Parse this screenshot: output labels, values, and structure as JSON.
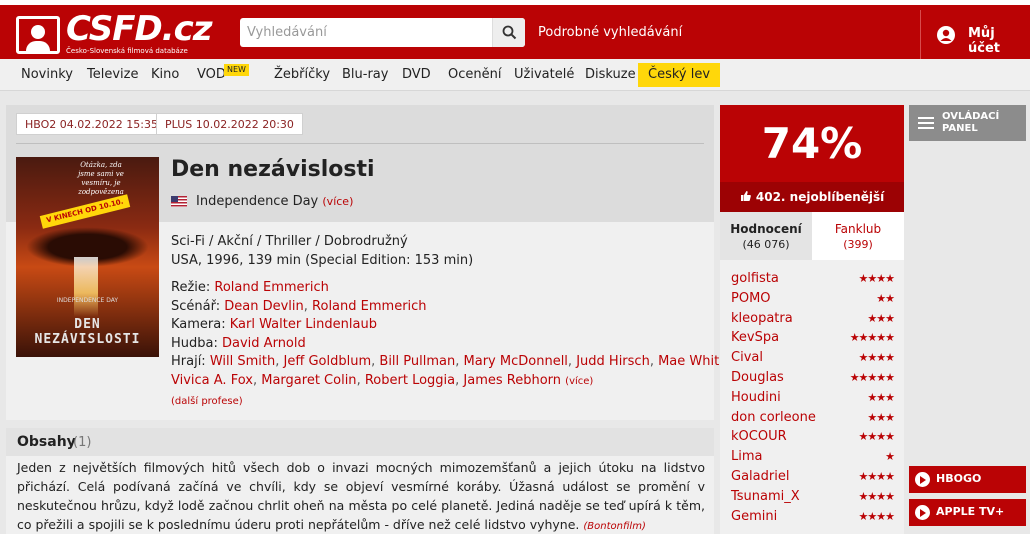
{
  "header": {
    "logo_text": "CSFD.cz",
    "logo_sub": "Česko-Slovenská filmová databáze",
    "search_placeholder": "Vyhledávání",
    "advanced_search": "Podrobné vyhledávání",
    "account": "Můj účet"
  },
  "nav": {
    "items": [
      "Novinky",
      "Televize",
      "Kino",
      "VOD",
      "Žebříčky",
      "Blu-ray",
      "DVD",
      "Ocenění",
      "Uživatelé",
      "Diskuze",
      "Český lev"
    ],
    "new_badge": "NEW"
  },
  "tv": {
    "badge1": "HBO2 04.02.2022 15:35",
    "badge2": "PLUS 10.02.2022 20:30"
  },
  "poster": {
    "tagline": "Otázka, zda jsme sami ve vesmíru, je zodpovězena",
    "banner": "V KINECH OD 10.10.",
    "small": "INDEPENDENCE DAY",
    "title": "DEN NEZÁVISLOSTI"
  },
  "film": {
    "title": "Den nezávislosti",
    "original_title": "Independence Day",
    "more": "(více)",
    "genres": "Sci-Fi / Akční / Thriller / Dobrodružný",
    "origin": "USA, 1996, 139 min (Special Edition: 153 min)"
  },
  "creators": {
    "direction_label": "Režie:",
    "direction": [
      "Roland Emmerich"
    ],
    "script_label": "Scénář:",
    "script": [
      "Dean Devlin",
      "Roland Emmerich"
    ],
    "camera_label": "Kamera:",
    "camera": [
      "Karl Walter Lindenlaub"
    ],
    "music_label": "Hudba:",
    "music": [
      "David Arnold"
    ],
    "cast_label": "Hrají:",
    "cast_line1": [
      "Will Smith",
      "Jeff Goldblum",
      "Bill Pullman",
      "Mary McDonnell",
      "Judd Hirsch",
      "Mae Whitman"
    ],
    "cast_line2": [
      "Vivica A. Fox",
      "Margaret Colin",
      "Robert Loggia",
      "James Rebhorn"
    ],
    "cast_more": "(více)",
    "more_professions": "(další profese)"
  },
  "synopsis": {
    "heading": "Obsahy",
    "count": "(1)",
    "text": "Jeden z největších filmových hitů všech dob o invazi mocných mimozemšťanů a jejich útoku na lidstvo přichází. Celá podívaná začíná ve chvíli, kdy se objeví vesmírné koráby. Úžasná událost se promění v neskutečnou hrůzu, když lodě začnou chrlit oheň na města po celé planetě. Jediná naděje se teď upírá k těm, co přežili a spojili se k poslednímu úderu proti nepřátelům - dříve než celé lidstvo vyhyne.",
    "source": "(Bontonfilm)"
  },
  "rating": {
    "score": "74%",
    "rank": "402. nejoblíbenější",
    "tab1_label": "Hodnocení",
    "tab1_count": "(46 076)",
    "tab2_label": "Fanklub",
    "tab2_count": "(399)",
    "users": [
      {
        "name": "golfista",
        "stars": 4
      },
      {
        "name": "POMO",
        "stars": 2
      },
      {
        "name": "kleopatra",
        "stars": 3
      },
      {
        "name": "KevSpa",
        "stars": 5
      },
      {
        "name": "Cival",
        "stars": 4
      },
      {
        "name": "Douglas",
        "stars": 5
      },
      {
        "name": "Houdini",
        "stars": 3
      },
      {
        "name": "don corleone",
        "stars": 3
      },
      {
        "name": "kOCOUR",
        "stars": 4
      },
      {
        "name": "Lima",
        "stars": 1
      },
      {
        "name": "Galadriel",
        "stars": 4
      },
      {
        "name": "Tsunami_X",
        "stars": 4
      },
      {
        "name": "Gemini",
        "stars": 4
      }
    ]
  },
  "side": {
    "control_panel": "OVLÁDACÍ PANEL",
    "vod1": "HBOGO",
    "vod2": "APPLE TV+"
  },
  "colors": {
    "brand": "#ba0305",
    "highlight": "#ffd70a"
  }
}
